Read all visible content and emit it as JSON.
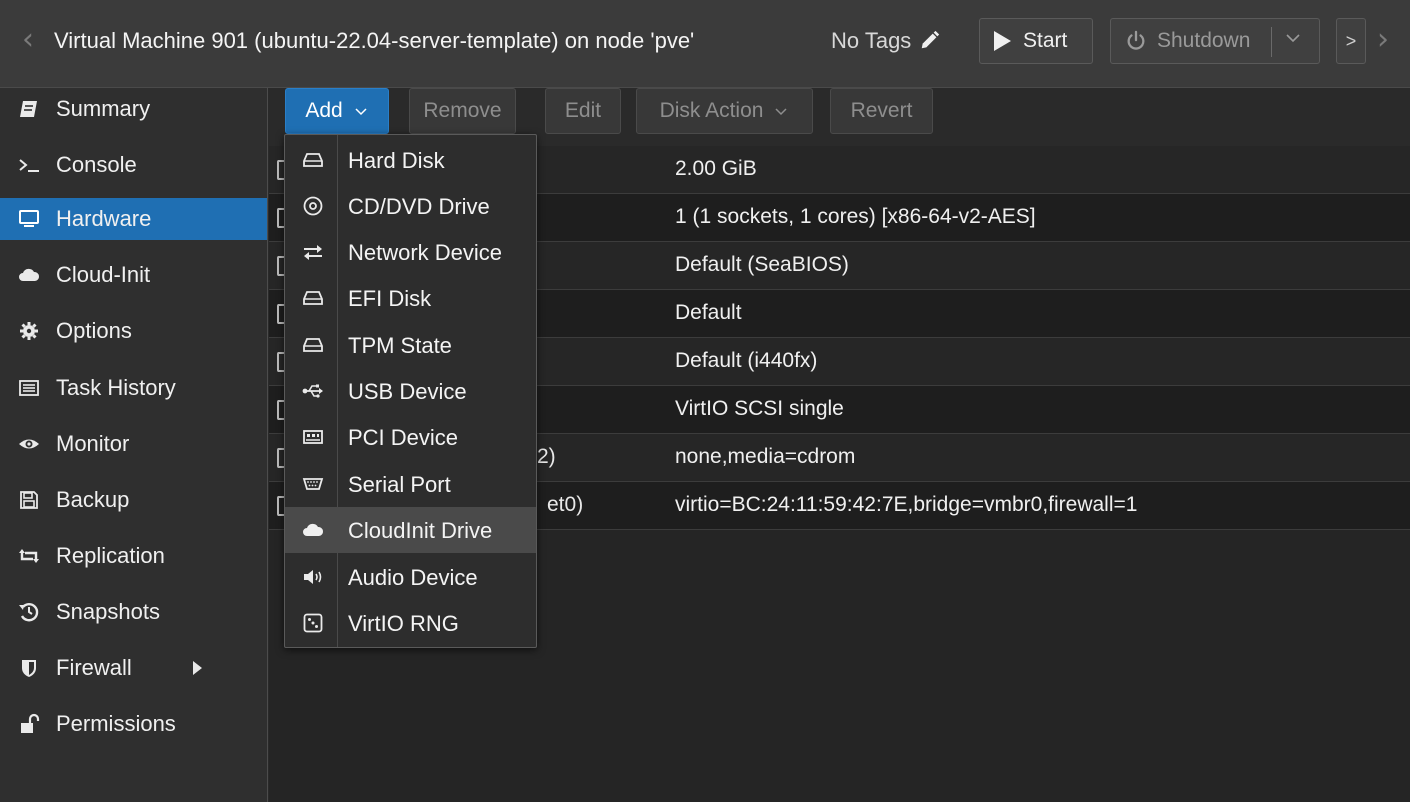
{
  "header": {
    "title": "Virtual Machine 901 (ubuntu-22.04-server-template) on node 'pve'",
    "tags_label": "No Tags",
    "start_label": "Start",
    "shutdown_label": "Shutdown",
    "more_label": ">"
  },
  "sidebar": {
    "items": [
      {
        "label": "Summary",
        "icon": "book-icon"
      },
      {
        "label": "Console",
        "icon": "terminal-icon"
      },
      {
        "label": "Hardware",
        "icon": "monitor-icon"
      },
      {
        "label": "Cloud-Init",
        "icon": "cloud-icon"
      },
      {
        "label": "Options",
        "icon": "gear-icon"
      },
      {
        "label": "Task History",
        "icon": "list-icon"
      },
      {
        "label": "Monitor",
        "icon": "eye-icon"
      },
      {
        "label": "Backup",
        "icon": "floppy-icon"
      },
      {
        "label": "Replication",
        "icon": "retweet-icon"
      },
      {
        "label": "Snapshots",
        "icon": "history-icon"
      },
      {
        "label": "Firewall",
        "icon": "shield-icon"
      },
      {
        "label": "Permissions",
        "icon": "unlock-icon"
      }
    ],
    "active": "Hardware"
  },
  "toolbar": {
    "add_label": "Add",
    "remove_label": "Remove",
    "edit_label": "Edit",
    "disk_action_label": "Disk Action",
    "revert_label": "Revert"
  },
  "hardware_rows": [
    {
      "key_fragment": "",
      "value": "2.00 GiB"
    },
    {
      "key_fragment": "",
      "value": "1 (1 sockets, 1 cores) [x86-64-v2-AES]"
    },
    {
      "key_fragment": "",
      "value": "Default (SeaBIOS)"
    },
    {
      "key_fragment": "",
      "value": "Default"
    },
    {
      "key_fragment": "",
      "value": "Default (i440fx)"
    },
    {
      "key_fragment": "",
      "value": "VirtIO SCSI single"
    },
    {
      "key_fragment": "2)",
      "value": "none,media=cdrom"
    },
    {
      "key_fragment": "et0)",
      "value": "virtio=BC:24:11:59:42:7E,bridge=vmbr0,firewall=1"
    }
  ],
  "add_menu": {
    "items": [
      {
        "label": "Hard Disk",
        "icon": "hdd-icon"
      },
      {
        "label": "CD/DVD Drive",
        "icon": "disc-icon"
      },
      {
        "label": "Network Device",
        "icon": "exchange-icon"
      },
      {
        "label": "EFI Disk",
        "icon": "hdd-icon"
      },
      {
        "label": "TPM State",
        "icon": "hdd-icon"
      },
      {
        "label": "USB Device",
        "icon": "usb-icon"
      },
      {
        "label": "PCI Device",
        "icon": "pci-card-icon"
      },
      {
        "label": "Serial Port",
        "icon": "serial-port-icon"
      },
      {
        "label": "CloudInit Drive",
        "icon": "cloud-icon"
      },
      {
        "label": "Audio Device",
        "icon": "speaker-icon"
      },
      {
        "label": "VirtIO RNG",
        "icon": "dice-icon"
      }
    ],
    "hovered": "CloudInit Drive"
  },
  "colors": {
    "accent": "#1f6fb3",
    "background": "#2a2a2a",
    "menu_hover": "#4a4a4a"
  }
}
